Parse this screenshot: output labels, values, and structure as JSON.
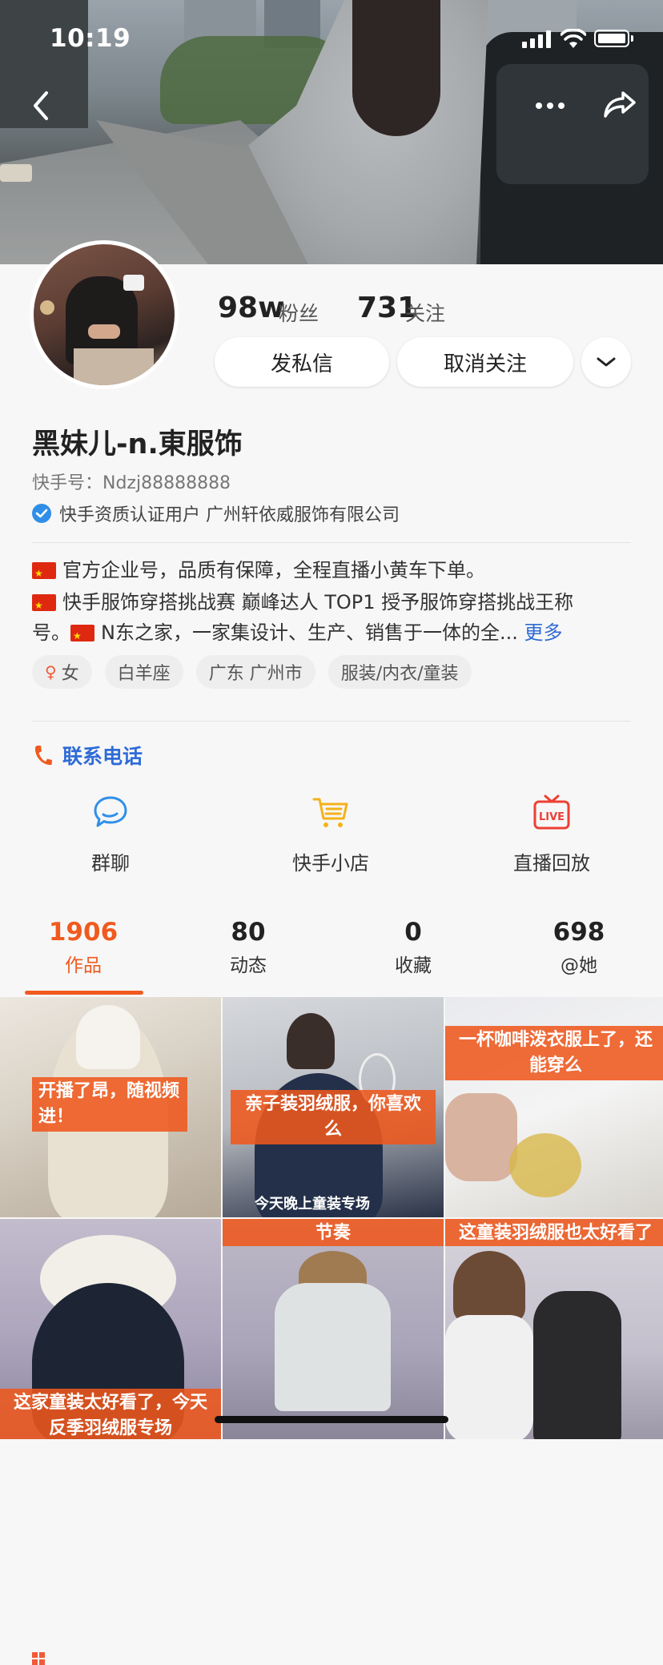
{
  "status_bar": {
    "time": "10:19"
  },
  "profile": {
    "fans_count": "98w",
    "fans_label": "粉丝",
    "following_count": "731",
    "following_label": "关注",
    "message_button": "发私信",
    "unfollow_button": "取消关注",
    "name": "黑妹儿-n.東服饰",
    "kwai_id": "快手号：Ndzj88888888",
    "verification": "快手资质认证用户 广州轩依威服饰有限公司",
    "bio_line1": "官方企业号，品质有保障，全程直播小黄车下单。",
    "bio_line2": "快手服饰穿搭挑战赛 巅峰达人 TOP1 授予服饰穿搭挑战王称",
    "bio_line3a": "号。",
    "bio_line3b": "N东之家，一家集设计、生产、销售于一体的全...",
    "bio_more": "更多",
    "tags": [
      "女",
      "白羊座",
      "广东 广州市",
      "服装/内衣/童装"
    ],
    "contact_phone": "联系电话",
    "features": [
      {
        "label": "群聊",
        "icon": "chat-bubble-icon"
      },
      {
        "label": "快手小店",
        "icon": "shopping-cart-icon"
      },
      {
        "label": "直播回放",
        "icon": "live-tv-icon"
      }
    ]
  },
  "tabs": [
    {
      "count": "1906",
      "label": "作品",
      "active": true
    },
    {
      "count": "80",
      "label": "动态"
    },
    {
      "count": "0",
      "label": "收藏"
    },
    {
      "count": "698",
      "label": "@她"
    }
  ],
  "videos": [
    {
      "caption": "开播了昂，随视频进！"
    },
    {
      "caption": "亲子装羽绒服，你喜欢么",
      "subtitle": "今天晚上童装专场"
    },
    {
      "caption": "一杯咖啡泼衣服上了，还能穿么"
    },
    {
      "caption": "这家童装太好看了，今天反季羽绒服专场"
    },
    {
      "caption": "节奏"
    },
    {
      "caption": "这童装羽绒服也太好看了"
    }
  ],
  "colors": {
    "accent": "#f05a1e",
    "link": "#2f6bd6",
    "verify": "#2f8fe8"
  }
}
